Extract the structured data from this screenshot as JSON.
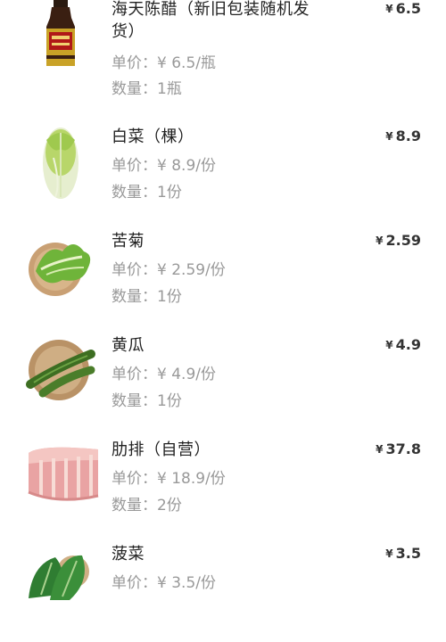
{
  "currency": "¥",
  "items": [
    {
      "name": "海天陈醋（新旧包装随机发货）",
      "unit_price": "单价：¥ 6.5/瓶",
      "quantity": "数量：1瓶",
      "total": "6.5",
      "image_icon": "vinegar-bottle-icon"
    },
    {
      "name": "白菜（棵）",
      "unit_price": "单价：¥ 8.9/份",
      "quantity": "数量：1份",
      "total": "8.9",
      "image_icon": "cabbage-icon"
    },
    {
      "name": "苦菊",
      "unit_price": "单价：¥ 2.59/份",
      "quantity": "数量：1份",
      "total": "2.59",
      "image_icon": "endive-icon"
    },
    {
      "name": "黄瓜",
      "unit_price": "单价：¥ 4.9/份",
      "quantity": "数量：1份",
      "total": "4.9",
      "image_icon": "cucumber-icon"
    },
    {
      "name": "肋排（自营）",
      "unit_price": "单价：¥ 18.9/份",
      "quantity": "数量：2份",
      "total": "37.8",
      "image_icon": "pork-ribs-icon"
    },
    {
      "name": "菠菜",
      "unit_price": "单价：¥ 3.5/份",
      "quantity": "",
      "total": "3.5",
      "image_icon": "spinach-icon"
    }
  ]
}
